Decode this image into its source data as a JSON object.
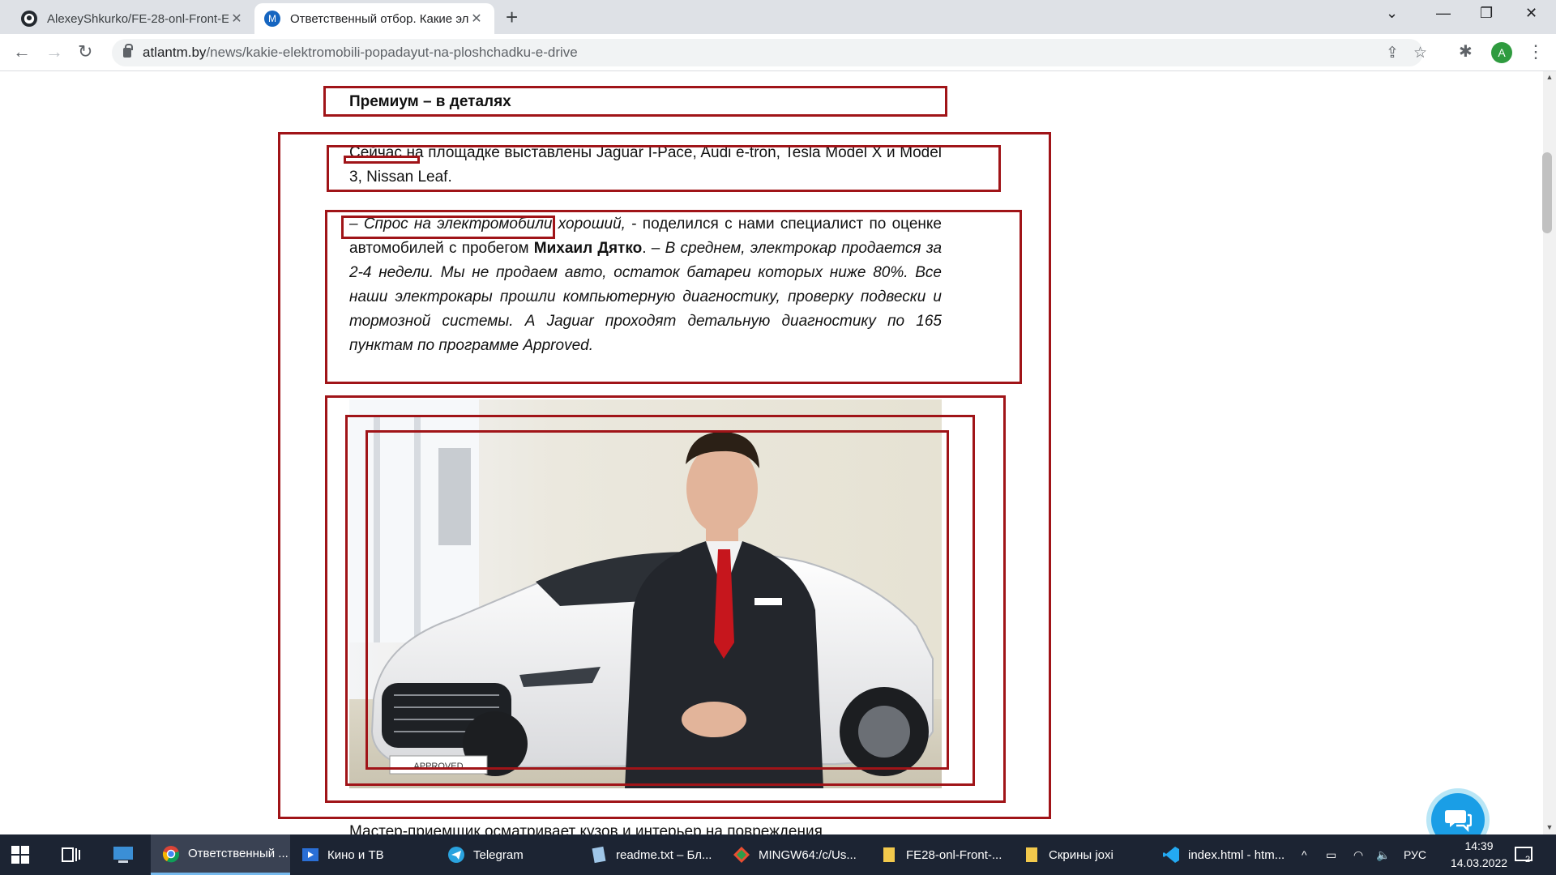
{
  "browser": {
    "tabs": [
      {
        "title": "AlexeyShkurko/FE-28-onl-Front-E",
        "active": false
      },
      {
        "title": "Ответственный отбор. Какие эл",
        "active": true,
        "favicon_letter": "M"
      }
    ],
    "url_host": "atlantm.by",
    "url_path": "/news/kakie-elektromobili-popadayut-na-ploshchadku-e-drive",
    "profile_initial": "A"
  },
  "article": {
    "heading": "Премиум – в деталях",
    "p1": "Сейчас на площадке выставлены Jaguar I-Pace, Audi e-tron, Tesla Model X и Model 3, Nissan Leaf.",
    "p2_italic_a": "– Спрос на электромобили хороший,",
    "p2_plain_a": " - поделился с нами специалист по оценке автомобилей с пробегом ",
    "p2_bold": "Михаил Дятко",
    "p2_plain_b": ". – ",
    "p2_italic_b": "В среднем, электрокар продается за 2-4 недели. Мы не продаем авто, остаток батареи которых ниже 80%. Все наши электрокары прошли компьютерную диагностику, проверку подвески и тормозной системы. А Jaguar проходят детальную диагностику по 165 пунктам по программе Approved.",
    "p3_cut": "Мастер-приемщик осматривает кузов и интерьер на повреждения",
    "photo_plate": "APPROVED"
  },
  "taskbar": {
    "items": [
      {
        "label": "Ответственный ...",
        "icon": "chrome-icon",
        "active": true
      },
      {
        "label": "Кино и ТВ",
        "icon": "movies-icon",
        "active": false
      },
      {
        "label": "Telegram",
        "icon": "telegram-icon",
        "active": false
      },
      {
        "label": "readme.txt – Бл...",
        "icon": "notepad-icon",
        "active": false
      },
      {
        "label": "MINGW64:/c/Us...",
        "icon": "git-bash-icon",
        "active": false
      },
      {
        "label": "FE28-onl-Front-...",
        "icon": "folder-icon",
        "active": false
      },
      {
        "label": "Скрины joxi",
        "icon": "folder-icon",
        "active": false
      },
      {
        "label": "index.html - htm...",
        "icon": "vscode-icon",
        "active": false
      }
    ],
    "lang": "РУС",
    "time": "14:39",
    "date": "14.03.2022",
    "notification_count": "2"
  },
  "colors": {
    "annotation": "#a01418",
    "chat_button": "#1a9ee6",
    "taskbar": "#1c2433",
    "tab_strip": "#dee1e6"
  }
}
